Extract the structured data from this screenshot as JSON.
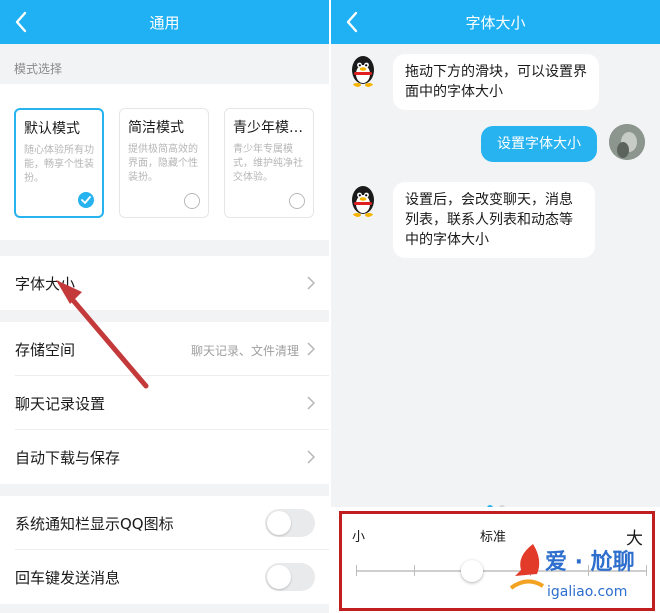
{
  "left": {
    "title": "通用",
    "section_label": "模式选择",
    "modes": [
      {
        "name": "默认模式",
        "desc": "随心体验所有功能，畅享个性装扮。",
        "selected": true
      },
      {
        "name": "简洁模式",
        "desc": "提供极简高效的界面，隐藏个性装扮。",
        "selected": false
      },
      {
        "name": "青少年模…",
        "desc": "青少年专属模式，维护纯净社交体验。",
        "selected": false
      }
    ],
    "rows": {
      "font_size": "字体大小",
      "storage": "存储空间",
      "storage_value": "聊天记录、文件清理",
      "chat_history": "聊天记录设置",
      "auto_download": "自动下载与保存",
      "notify_icon": "系统通知栏显示QQ图标",
      "enter_send": "回车键发送消息"
    },
    "toggles": {
      "notify_icon": false,
      "enter_send": false
    }
  },
  "right": {
    "title": "字体大小",
    "messages": [
      {
        "side": "in",
        "text": "拖动下方的滑块，可以设置界面中的字体大小"
      },
      {
        "side": "out",
        "text": "设置字体大小"
      },
      {
        "side": "in",
        "text": "设置后，会改变聊天，消息列表，联系人列表和动态等中的字体大小"
      }
    ],
    "slider": {
      "label_small": "小",
      "label_standard": "标准",
      "label_large": "大",
      "level": 2,
      "levels": 6
    },
    "page_dots": {
      "count": 2,
      "active": 0
    }
  },
  "watermark": {
    "text": "爱 · 尬聊",
    "url": "igaliao.com"
  },
  "colors": {
    "accent": "#27b3ef",
    "titlebar": "#1fb1f3",
    "highlight_box": "#c11f1f",
    "arrow": "#c43a3a"
  }
}
